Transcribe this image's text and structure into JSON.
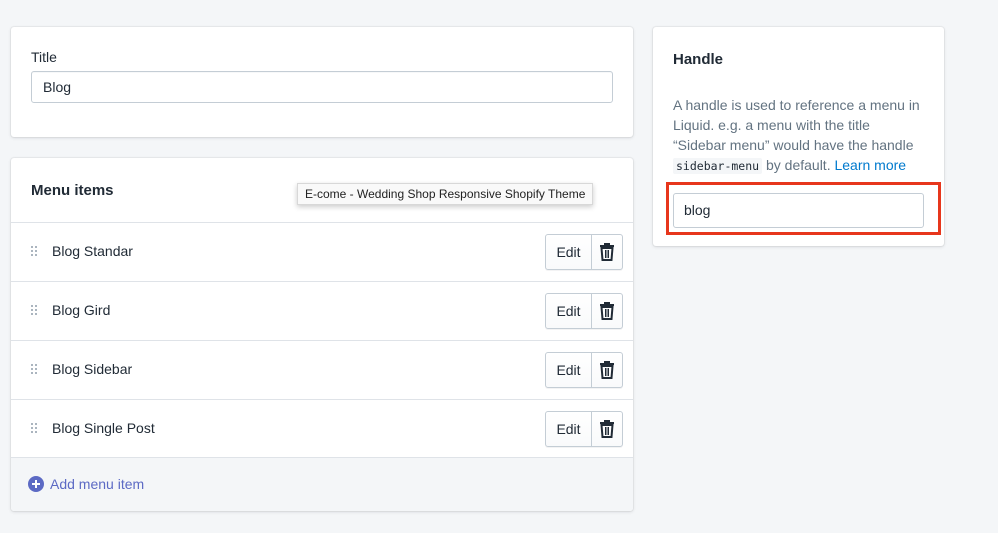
{
  "title_section": {
    "label": "Title",
    "value": "Blog"
  },
  "menu": {
    "heading": "Menu items",
    "tooltip": "E-come - Wedding Shop Responsive Shopify Theme",
    "items": [
      {
        "label": "Blog Standar",
        "edit_label": "Edit"
      },
      {
        "label": "Blog Gird",
        "edit_label": "Edit"
      },
      {
        "label": "Blog Sidebar",
        "edit_label": "Edit"
      },
      {
        "label": "Blog Single Post",
        "edit_label": "Edit"
      }
    ],
    "add_label": "Add menu item",
    "icons": {
      "drag": "drag-handle-icon",
      "delete": "trash-icon",
      "add": "plus-circle-icon"
    }
  },
  "handle": {
    "heading": "Handle",
    "desc_part1": "A handle is used to reference a menu in Liquid. e.g. a menu with the title “Sidebar menu” would have the handle ",
    "code": "sidebar-menu",
    "desc_part2": " by default. ",
    "learn_more": "Learn more",
    "value": "blog"
  },
  "colors": {
    "accent": "#5c6ac4",
    "link": "#007ace",
    "highlight": "#e7361c",
    "background": "#f4f6f8"
  }
}
